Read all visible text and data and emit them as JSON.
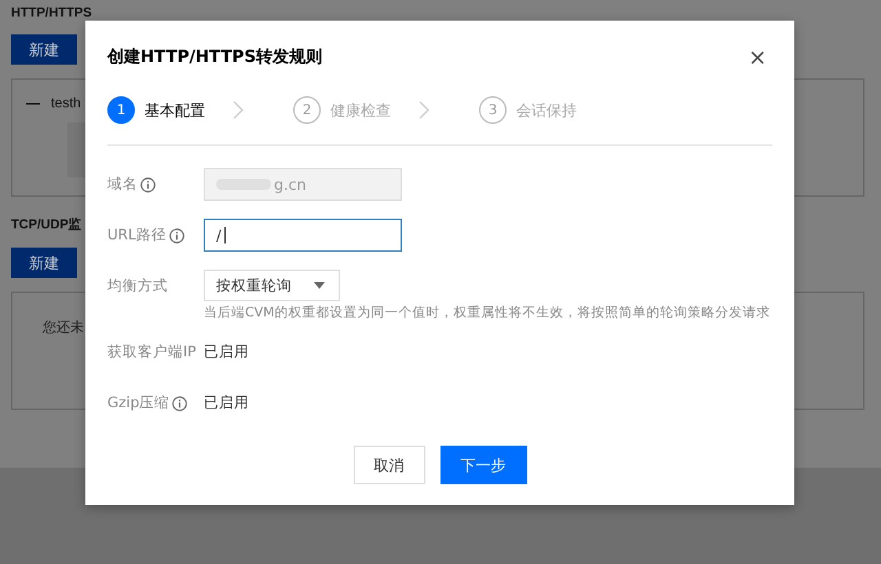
{
  "background_page": {
    "sections": [
      {
        "title": "HTTP/HTTPS",
        "button": "新建",
        "tree_item": "testh"
      },
      {
        "title": "TCP/UDP监",
        "button": "新建",
        "empty_text": "您还未"
      }
    ]
  },
  "dialog": {
    "title": "创建HTTP/HTTPS转发规则",
    "close": "×",
    "steps": [
      {
        "number": "1",
        "label": "基本配置",
        "selected": true
      },
      {
        "number": "2",
        "label": "健康检查",
        "selected": false
      },
      {
        "number": "3",
        "label": "会话保持",
        "selected": false
      }
    ],
    "fields": [
      {
        "kind": "input",
        "label": "域名",
        "info": true,
        "value": "g.cn",
        "disabled": true,
        "focused": false
      },
      {
        "kind": "input",
        "label": "URL路径",
        "info": true,
        "value": "/",
        "disabled": false,
        "focused": true
      },
      {
        "kind": "select",
        "label": "均衡方式",
        "info": false,
        "value": "按权重轮询",
        "hint": "当后端CVM的权重都设置为同一个值时，权重属性将不生效，将按照简单的轮询策略分发请求"
      },
      {
        "kind": "text",
        "label": "获取客户端IP",
        "info": false,
        "value": "已启用"
      },
      {
        "kind": "text",
        "label": "Gzip压缩",
        "info": true,
        "value": "已启用"
      }
    ],
    "buttons": [
      {
        "label": "取消",
        "primary": false
      },
      {
        "label": "下一步",
        "primary": true
      }
    ]
  }
}
